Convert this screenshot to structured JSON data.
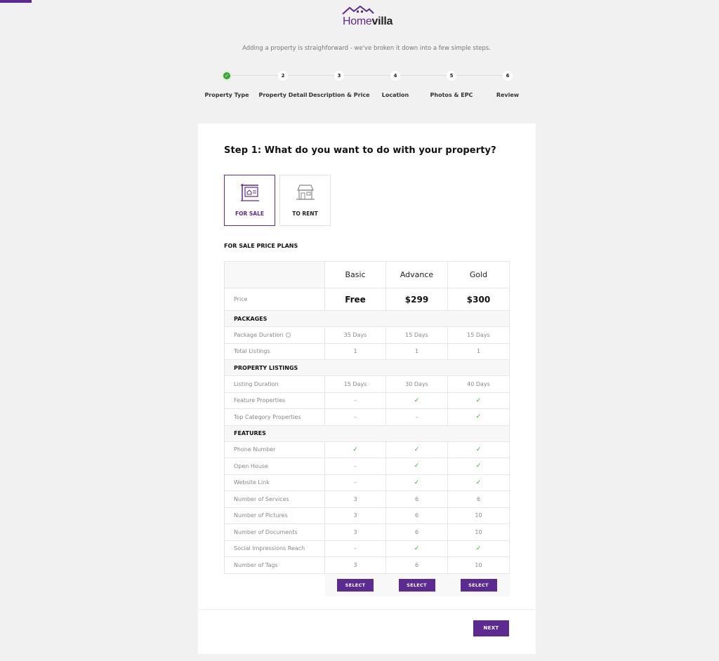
{
  "brand": {
    "home": "Home",
    "villa": "villa",
    "accent": "#5b2b91"
  },
  "intro": "Adding a property is straighforward - we've broken it down into a few simple steps.",
  "steps": [
    {
      "num": "✓",
      "label": "Property Type",
      "done": true
    },
    {
      "num": "2",
      "label": "Property Detail"
    },
    {
      "num": "3",
      "label": "Description & Price"
    },
    {
      "num": "4",
      "label": "Location"
    },
    {
      "num": "5",
      "label": "Photos & EPC"
    },
    {
      "num": "6",
      "label": "Review"
    }
  ],
  "card": {
    "title": "Step 1: What do you want to do with your property?",
    "options": [
      {
        "label": "FOR SALE",
        "icon": "for-sale-sign-icon",
        "selected": true
      },
      {
        "label": "TO RENT",
        "icon": "house-icon",
        "selected": false
      }
    ],
    "plans_heading": "FOR SALE PRICE PLANS"
  },
  "plans": {
    "columns": [
      "Basic",
      "Advance",
      "Gold"
    ],
    "price_label": "Price",
    "prices": [
      "Free",
      "$299",
      "$300"
    ],
    "sections": [
      {
        "name": "PACKAGES",
        "rows": [
          {
            "label": "Package Duration",
            "info": true,
            "values": [
              "35 Days",
              "15 Days",
              "15 Days"
            ]
          },
          {
            "label": "Total Listings",
            "values": [
              "1",
              "1",
              "1"
            ]
          }
        ]
      },
      {
        "name": "PROPERTY LISTINGS",
        "rows": [
          {
            "label": "Listing Duration",
            "values": [
              "15 Days",
              "30 Days",
              "40 Days"
            ]
          },
          {
            "label": "Feature Properties",
            "values": [
              "–",
              "✓",
              "✓"
            ]
          },
          {
            "label": "Top Category Properties",
            "values": [
              "–",
              "–",
              "✓"
            ]
          }
        ]
      },
      {
        "name": "FEATURES",
        "rows": [
          {
            "label": "Phone Number",
            "values": [
              "✓",
              "✓",
              "✓"
            ]
          },
          {
            "label": "Open House",
            "values": [
              "–",
              "✓",
              "✓"
            ]
          },
          {
            "label": "Website Link",
            "values": [
              "–",
              "✓",
              "✓"
            ]
          },
          {
            "label": "Number of Services",
            "values": [
              "3",
              "6",
              "6"
            ]
          },
          {
            "label": "Number of Pictures",
            "values": [
              "3",
              "6",
              "10"
            ]
          },
          {
            "label": "Number of Documents",
            "values": [
              "3",
              "6",
              "10"
            ]
          },
          {
            "label": "Social Impressions Reach",
            "values": [
              "–",
              "✓",
              "✓"
            ]
          },
          {
            "label": "Number of Tags",
            "values": [
              "3",
              "6",
              "10"
            ]
          }
        ]
      }
    ],
    "select_label": "SELECT"
  },
  "next_label": "NEXT"
}
